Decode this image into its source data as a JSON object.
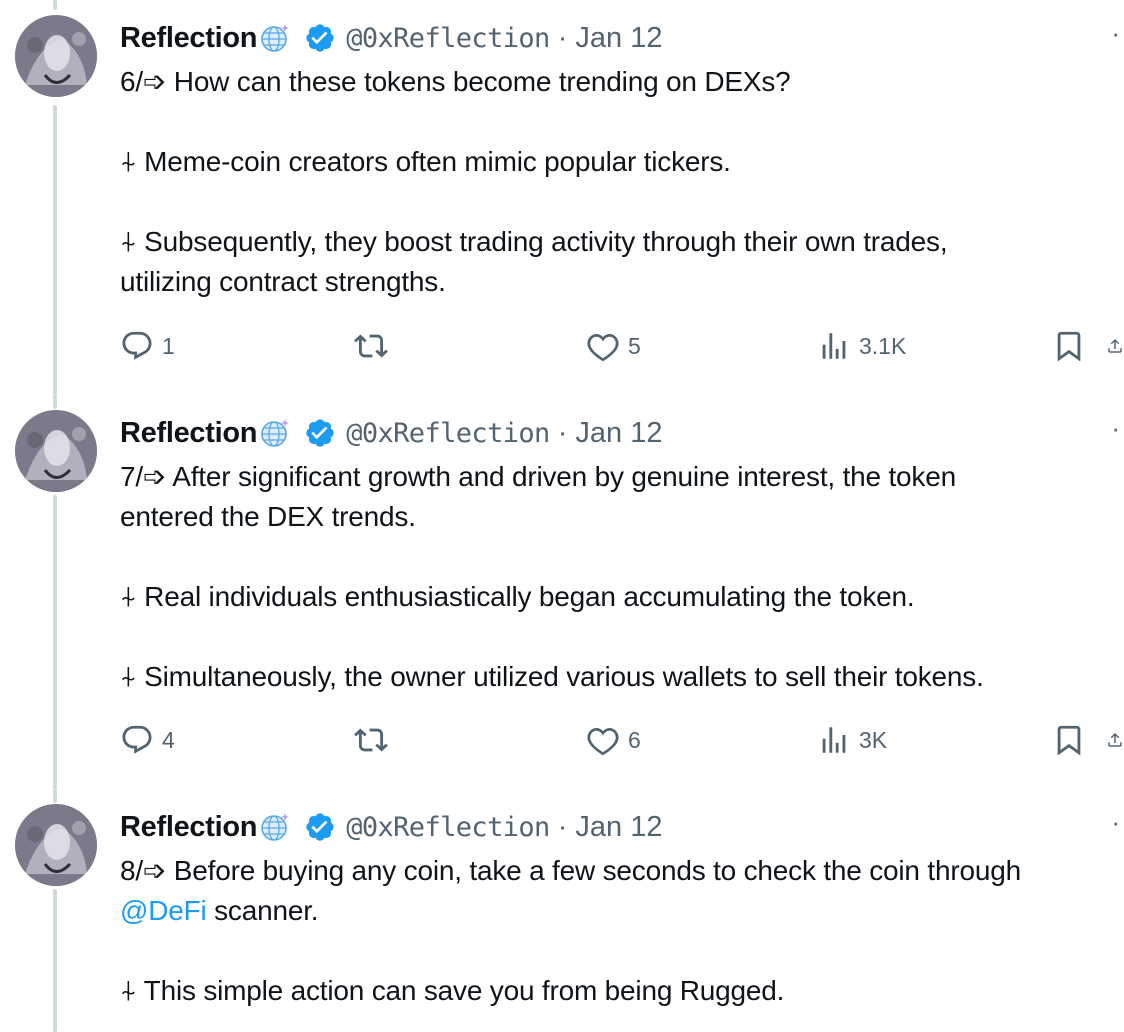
{
  "tweets": [
    {
      "author": "Reflection",
      "handle": "@0xReflection",
      "separator": "·",
      "date": "Jan 12",
      "more": "·",
      "lines": [
        "6/➩ How can these tokens become trending on DEXs?",
        "",
        "⍭ Meme-coin creators often mimic popular tickers.",
        "",
        "⍭ Subsequently, they boost trading activity through their own trades,",
        "utilizing contract strengths."
      ],
      "stats": {
        "replies": "1",
        "likes": "5",
        "views": "3.1K"
      }
    },
    {
      "author": "Reflection",
      "handle": "@0xReflection",
      "separator": "·",
      "date": "Jan 12",
      "more": "·",
      "lines": [
        "7/➩ After significant growth and driven by genuine interest, the token",
        "entered the DEX trends.",
        "",
        "⍭ Real individuals enthusiastically began accumulating the token.",
        "",
        "⍭ Simultaneously, the owner utilized various wallets to sell their tokens."
      ],
      "stats": {
        "replies": "4",
        "likes": "6",
        "views": "3K"
      }
    },
    {
      "author": "Reflection",
      "handle": "@0xReflection",
      "separator": "·",
      "date": "Jan 12",
      "more": "·",
      "line1": "8/➩ Before buying any coin, take a few seconds to check the coin through",
      "mention": "@DeFi",
      "line2_rest": " scanner.",
      "line3": "⍭ This simple action can save you from being Rugged."
    }
  ],
  "colors": {
    "text": "#0f1419",
    "secondary": "#536471",
    "link": "#1d9bf0",
    "verified": "#1d9bf0",
    "thread_line": "#cfd9de"
  },
  "icons": {
    "badge": "globe-icon",
    "verified": "verified-badge-icon",
    "reply": "reply-icon",
    "retweet": "retweet-icon",
    "like": "heart-icon",
    "views": "views-icon",
    "bookmark": "bookmark-icon",
    "share": "share-icon"
  }
}
